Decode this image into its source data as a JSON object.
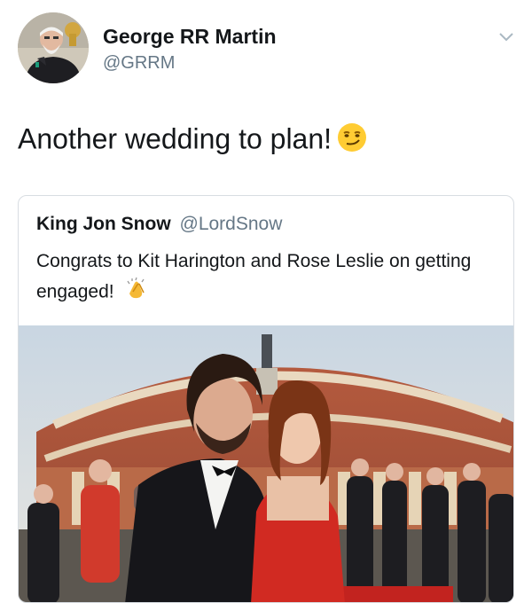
{
  "tweet": {
    "author_name": "George RR Martin",
    "author_handle": "@GRRM",
    "text": "Another wedding to plan!",
    "emoji_icon": "smirking-face-icon"
  },
  "quoted": {
    "author_name": "King Jon Snow",
    "author_handle": "@LordSnow",
    "text": "Congrats to Kit Harington and Rose Leslie on getting engaged!",
    "emoji_icon": "clapping-hands-icon"
  },
  "colors": {
    "text": "#14171a",
    "secondary_text": "#657786",
    "border": "#d8dde2"
  }
}
